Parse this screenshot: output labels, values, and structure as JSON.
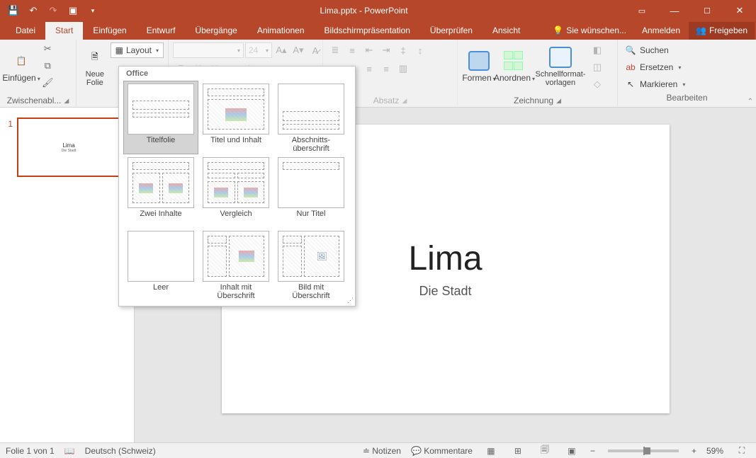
{
  "titlebar": {
    "doc_title": "Lima.pptx - PowerPoint"
  },
  "tabs": {
    "file": "Datei",
    "home": "Start",
    "insert": "Einfügen",
    "design": "Entwurf",
    "transitions": "Übergänge",
    "animations": "Animationen",
    "slideshow": "Bildschirmpräsentation",
    "review": "Überprüfen",
    "view": "Ansicht",
    "tellme": "Sie wünschen...",
    "signin": "Anmelden",
    "share": "Freigeben"
  },
  "ribbon": {
    "paste": "Einfügen",
    "clipboard_label": "Zwischenabl...",
    "new_slide": "Neue\nFolie",
    "layout": "Layout",
    "font_size": "24",
    "shapes": "Formen",
    "arrange": "Anordnen",
    "quick_styles": "Schnellformat-\nvorlagen",
    "paragraph_label": "Absatz",
    "drawing_label": "Zeichnung",
    "find": "Suchen",
    "replace": "Ersetzen",
    "select": "Markieren",
    "editing_label": "Bearbeiten"
  },
  "gallery": {
    "header": "Office",
    "items": [
      "Titelfolie",
      "Titel und Inhalt",
      "Abschnitts-\nüberschrift",
      "Zwei Inhalte",
      "Vergleich",
      "Nur Titel",
      "Leer",
      "Inhalt mit\nÜberschrift",
      "Bild mit\nÜberschrift"
    ]
  },
  "slide": {
    "number": "1",
    "title": "Lima",
    "subtitle": "Die Stadt"
  },
  "status": {
    "slide_count": "Folie 1 von 1",
    "language": "Deutsch (Schweiz)",
    "notes": "Notizen",
    "comments": "Kommentare",
    "zoom": "59%"
  }
}
